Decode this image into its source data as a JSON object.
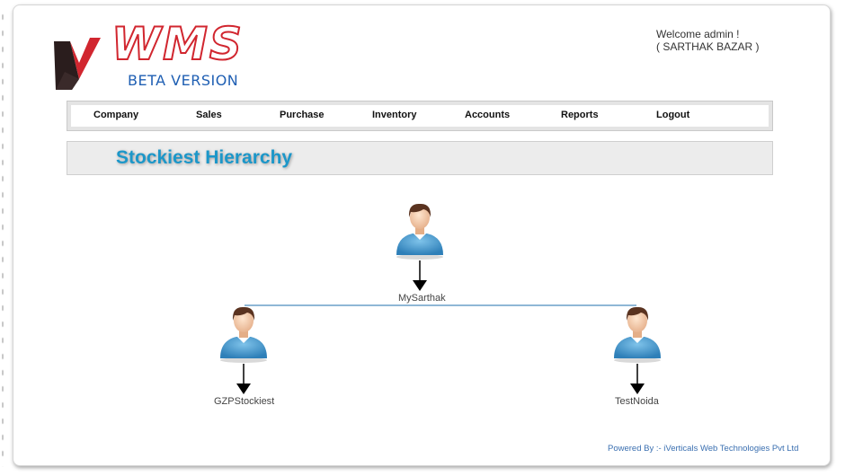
{
  "app": {
    "logo_text": "WMS",
    "logo_subtitle": "BETA VERSION"
  },
  "user": {
    "welcome": "Welcome admin !",
    "company": "( SARTHAK BAZAR )"
  },
  "nav": {
    "items": [
      {
        "label": "Company"
      },
      {
        "label": "Sales"
      },
      {
        "label": "Purchase"
      },
      {
        "label": "Inventory"
      },
      {
        "label": "Accounts"
      },
      {
        "label": "Reports"
      },
      {
        "label": "Logout"
      }
    ]
  },
  "page": {
    "title": "Stockiest Hierarchy"
  },
  "hierarchy": {
    "root": {
      "name": "MySarthak"
    },
    "children": [
      {
        "name": "GZPStockiest"
      },
      {
        "name": "TestNoida"
      }
    ]
  },
  "footer": {
    "text": "Powered By :- iVerticals Web Technologies Pvt Ltd"
  },
  "colors": {
    "title": "#1c97c9",
    "logo_red": "#d1262f",
    "logo_blue": "#1f5fb3",
    "connector": "#6a9fc9",
    "footer": "#3a6fb0"
  }
}
